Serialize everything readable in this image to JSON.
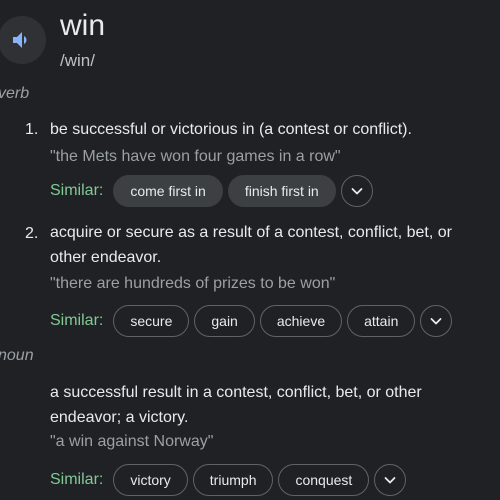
{
  "entry": {
    "word": "win",
    "phonetic": "/win/",
    "speaker_icon": "speaker-icon"
  },
  "verb": {
    "pos_label": "verb",
    "senses": [
      {
        "number": "1.",
        "definition": "be successful or victorious in (a contest or conflict).",
        "example": "\"the Mets have won four games in a row\"",
        "similar_label": "Similar:",
        "similar": [
          "come first in",
          "finish first in"
        ]
      },
      {
        "number": "2.",
        "definition": "acquire or secure as a result of a contest, conflict, bet, or other endeavor.",
        "example": "\"there are hundreds of prizes to be won\"",
        "similar_label": "Similar:",
        "similar": [
          "secure",
          "gain",
          "achieve",
          "attain"
        ]
      }
    ]
  },
  "noun": {
    "pos_label": "noun",
    "senses": [
      {
        "definition": "a successful result in a contest, conflict, bet, or other endeavor; a victory.",
        "example": "\"a win against Norway\"",
        "similar_label": "Similar:",
        "similar": [
          "victory",
          "triumph",
          "conquest"
        ]
      }
    ]
  },
  "icons": {
    "expand": "chevron-down-icon"
  },
  "colors": {
    "background": "#202124",
    "similar_label": "#81c995",
    "chip_border": "#5f6368",
    "chip_filled": "#3c4043",
    "muted_text": "#9aa0a6"
  }
}
